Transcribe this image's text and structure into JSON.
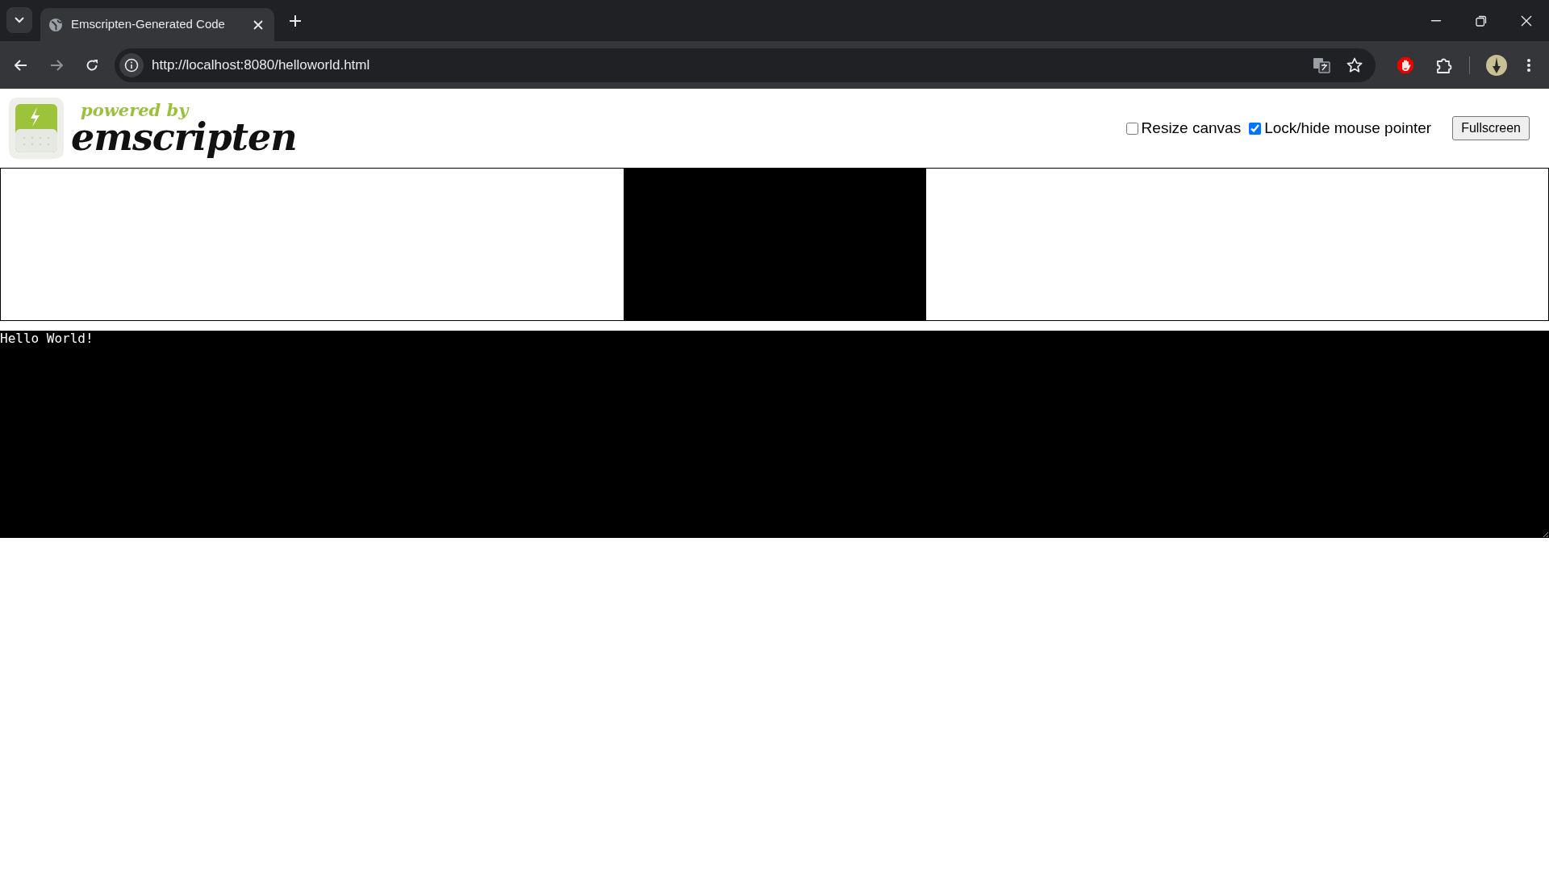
{
  "browser": {
    "tab": {
      "title": "Emscripten-Generated Code"
    },
    "address": "http://localhost:8080/helloworld.html"
  },
  "logo": {
    "tagline": "powered by",
    "name": "emscripten"
  },
  "options": [
    {
      "label": "Resize canvas",
      "checked": false
    },
    {
      "label": "Lock/hide mouse pointer",
      "checked": true
    }
  ],
  "fullscreen_button": "Fullscreen",
  "output": {
    "value": "Hello World!"
  }
}
